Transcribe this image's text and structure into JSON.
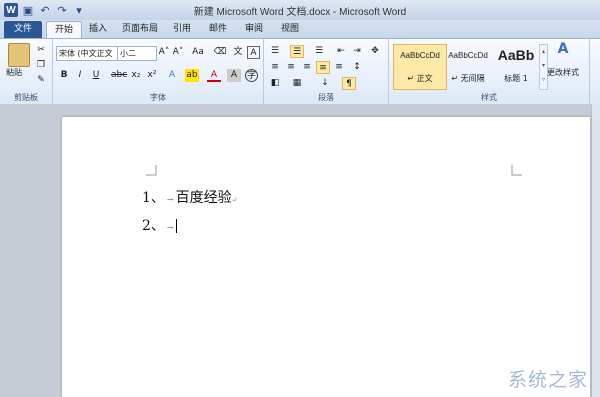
{
  "window": {
    "title": "新建 Microsoft Word 文档.docx - Microsoft Word"
  },
  "tabs": [
    "文件",
    "开始",
    "插入",
    "页面布局",
    "引用",
    "邮件",
    "审阅",
    "视图"
  ],
  "ribbon": {
    "clipboard": {
      "paste": "粘贴",
      "label": "剪贴板"
    },
    "font": {
      "family": "宋体 (中文正文",
      "size": "小二",
      "label": "字体"
    },
    "paragraph": {
      "label": "段落"
    },
    "styles": {
      "items": [
        {
          "sample": "AaBbCcDd",
          "name": "↵ 正文"
        },
        {
          "sample": "AaBbCcDd",
          "name": "↵ 无间隔"
        },
        {
          "sample": "AaBb",
          "name": "标题 1"
        }
      ],
      "change": "更改样式",
      "label": "样式"
    }
  },
  "document": {
    "lines": [
      {
        "number": "1、",
        "text": "百度经验"
      },
      {
        "number": "2、",
        "text": ""
      }
    ],
    "arrow": "→",
    "mark": "↵"
  },
  "watermark": "系统之家",
  "colors": {
    "accent": "#2b579a",
    "ribbon": "#dde8f6",
    "workspace": "#c6ccd6",
    "highlight": "#fde9a7"
  }
}
